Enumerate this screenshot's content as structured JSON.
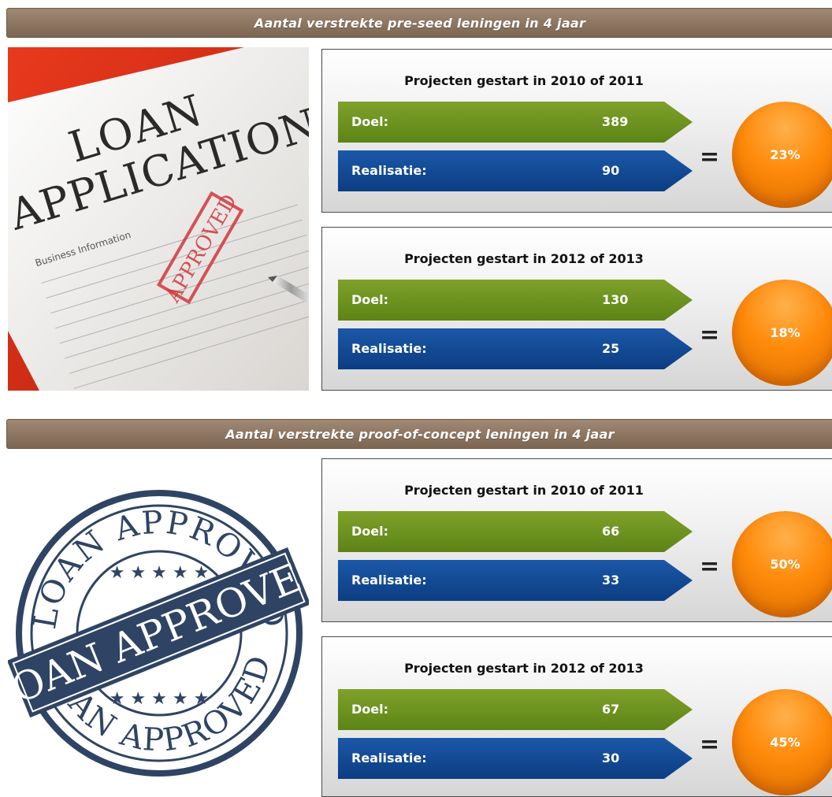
{
  "sections": [
    {
      "header": "Aantal verstrekte pre-seed leningen in 4 jaar",
      "image": {
        "title_line1": "LOAN",
        "title_line2": "APPLICATION",
        "stamp": "APPROVED",
        "form_heading": "Business Information"
      },
      "panels": [
        {
          "title": "Projecten gestart in 2010 of 2011",
          "goal_label": "Doel:",
          "goal_value": "389",
          "real_label": "Realisatie:",
          "real_value": "90",
          "equals": "=",
          "percent": "23%"
        },
        {
          "title": "Projecten gestart in 2012 of 2013",
          "goal_label": "Doel:",
          "goal_value": "130",
          "real_label": "Realisatie:",
          "real_value": "25",
          "equals": "=",
          "percent": "18%"
        }
      ]
    },
    {
      "header": "Aantal verstrekte proof-of-concept leningen in 4 jaar",
      "image": {
        "ring_top": "LOAN APPROVED",
        "ring_bottom": "LOAN APPROVED",
        "banner": "LOAN APPROVED"
      },
      "panels": [
        {
          "title": "Projecten gestart in 2010 of 2011",
          "goal_label": "Doel:",
          "goal_value": "66",
          "real_label": "Realisatie:",
          "real_value": "33",
          "equals": "=",
          "percent": "50%"
        },
        {
          "title": "Projecten gestart in 2012 of 2013",
          "goal_label": "Doel:",
          "goal_value": "67",
          "real_label": "Realisatie:",
          "real_value": "30",
          "equals": "=",
          "percent": "45%"
        }
      ]
    }
  ],
  "colors": {
    "header_bg": "#8c7561",
    "goal_bar": "#6a9020",
    "realisation_bar": "#0f4690",
    "circle": "#ff8a0a"
  }
}
